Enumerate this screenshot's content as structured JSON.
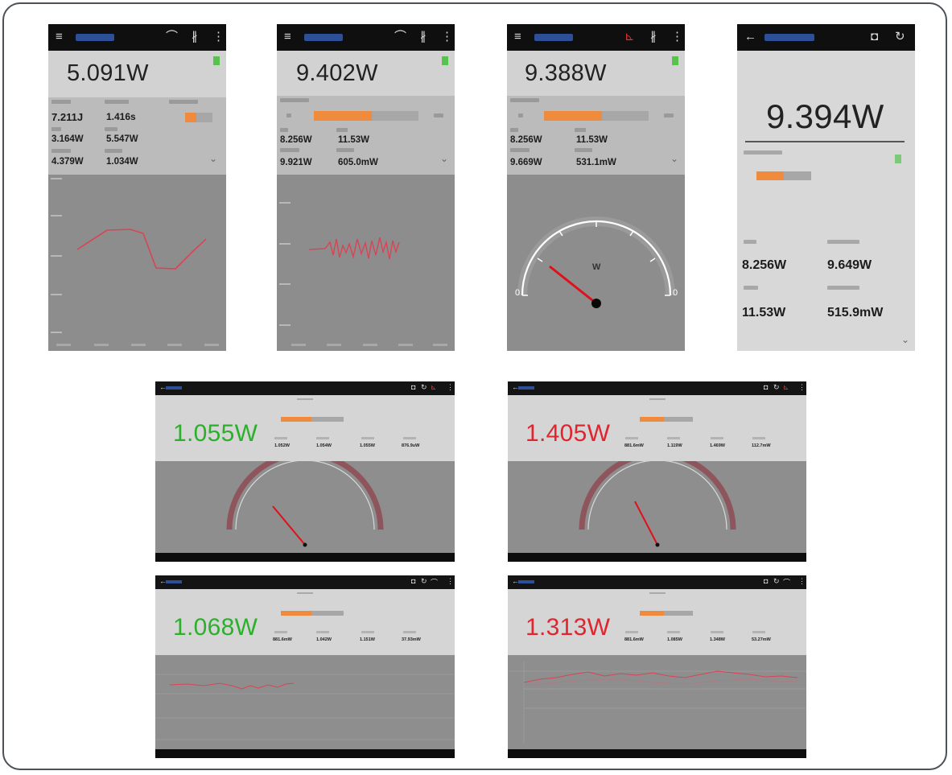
{
  "phones": [
    {
      "reading": "5.091W",
      "stats": [
        {
          "label": "",
          "value": "7.211J"
        },
        {
          "label": "",
          "value": "1.416s"
        },
        {
          "label": "",
          "value": "3.164W"
        },
        {
          "label": "",
          "value": "5.547W"
        },
        {
          "label": "",
          "value": "4.379W"
        },
        {
          "label": "",
          "value": "1.034W"
        }
      ]
    },
    {
      "reading": "9.402W",
      "stats": [
        {
          "value": "8.256W"
        },
        {
          "value": "11.53W"
        },
        {
          "value": "9.921W"
        },
        {
          "value": "605.0mW"
        }
      ]
    },
    {
      "reading": "9.388W",
      "stats": [
        {
          "value": "8.256W"
        },
        {
          "value": "11.53W"
        },
        {
          "value": "9.669W"
        },
        {
          "value": "531.1mW"
        }
      ],
      "gauge_unit": "W",
      "gauge_min": "0",
      "gauge_max": "0"
    },
    {
      "reading": "9.394W",
      "stats": [
        {
          "value": "8.256W"
        },
        {
          "value": "9.649W"
        },
        {
          "value": "11.53W"
        },
        {
          "value": "515.9mW"
        }
      ]
    }
  ],
  "tablets": [
    {
      "reading": "1.055W",
      "color": "#2bb02b",
      "stats": [
        "1.052W",
        "1.054W",
        "1.055W",
        "876.9uW"
      ]
    },
    {
      "reading": "1.405W",
      "color": "#e0252e",
      "stats": [
        "881.6mW",
        "1.119W",
        "1.469W",
        "112.7mW"
      ]
    },
    {
      "reading": "1.068W",
      "color": "#2bb02b",
      "stats": [
        "881.6mW",
        "1.042W",
        "1.151W",
        "37.93mW"
      ]
    },
    {
      "reading": "1.313W",
      "color": "#e0252e",
      "stats": [
        "881.6mW",
        "1.085W",
        "1.348W",
        "53.27mW"
      ]
    }
  ],
  "colors": {
    "accent": "#f08a3c",
    "trace": "#d94455",
    "needle": "#e0101a",
    "green": "#2bb02b",
    "red": "#e0252e",
    "toolbar": "#0f0f0f",
    "title_blue": "#2c4f97"
  },
  "icons": {
    "menu": "hamburger-menu-icon",
    "gauge": "gauge-icon",
    "bluetooth": "bluetooth-icon",
    "overflow": "overflow-menu-icon",
    "back": "back-arrow-icon",
    "camera": "camera-icon",
    "refresh": "refresh-icon",
    "flag": "flag-icon"
  }
}
